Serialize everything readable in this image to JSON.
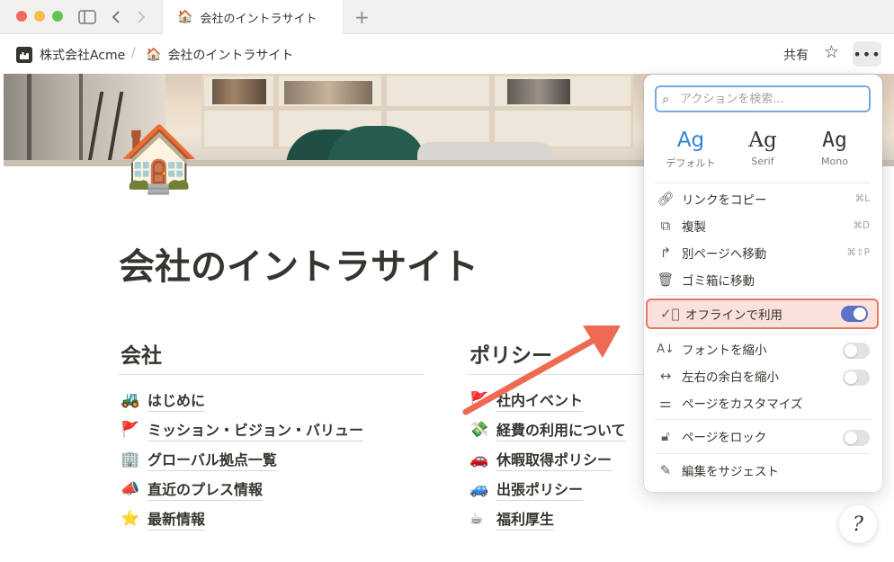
{
  "tab": {
    "emoji": "🏠",
    "title": "会社のイントラサイト"
  },
  "breadcrumb": {
    "workspace": "株式会社Acme",
    "separator": "/",
    "page_emoji": "🏠",
    "page": "会社のイントラサイト"
  },
  "topbar": {
    "share": "共有",
    "star_icon": "☆",
    "more_icon": "•••"
  },
  "page": {
    "icon": "🏠",
    "title": "会社のイントラサイト",
    "columns": [
      {
        "heading": "会社",
        "items": [
          {
            "emoji": "🚜",
            "label": "はじめに"
          },
          {
            "emoji": "🚩",
            "label": "ミッション・ビジョン・バリュー"
          },
          {
            "emoji": "🏢",
            "label": "グローバル拠点一覧"
          },
          {
            "emoji": "📣",
            "label": "直近のプレス情報"
          },
          {
            "emoji": "⭐",
            "label": "最新情報"
          }
        ]
      },
      {
        "heading": "ポリシー",
        "items": [
          {
            "emoji": "🚩",
            "label": "社内イベント"
          },
          {
            "emoji": "💸",
            "label": "経費の利用について"
          },
          {
            "emoji": "🚗",
            "label": "休暇取得ポリシー"
          },
          {
            "emoji": "🚙",
            "label": "出張ポリシー"
          },
          {
            "emoji": "☕",
            "label": "福利厚生"
          }
        ]
      }
    ]
  },
  "menu": {
    "search_placeholder": "アクションを検索...",
    "fonts": [
      {
        "sample": "Ag",
        "name": "デフォルト",
        "selected": true
      },
      {
        "sample": "Ag",
        "name": "Serif",
        "selected": false
      },
      {
        "sample": "Ag",
        "name": "Mono",
        "selected": false
      }
    ],
    "actions": [
      {
        "icon": "link-icon",
        "label": "リンクをコピー",
        "shortcut": "⌘L"
      },
      {
        "icon": "duplicate-icon",
        "label": "複製",
        "shortcut": "⌘D"
      },
      {
        "icon": "move-icon",
        "label": "別ページへ移動",
        "shortcut": "⌘⇧P"
      },
      {
        "icon": "trash-icon",
        "label": "ゴミ箱に移動",
        "shortcut": ""
      }
    ],
    "offline": {
      "label": "オフラインで利用",
      "enabled": true
    },
    "settings": [
      {
        "label": "フォントを縮小",
        "enabled": false
      },
      {
        "label": "左右の余白を縮小",
        "enabled": false
      },
      {
        "label": "ページをカスタマイズ"
      }
    ],
    "lock": {
      "label": "ページをロック",
      "enabled": false
    },
    "suggest": {
      "label": "編集をサジェスト"
    }
  },
  "colors": {
    "accent": "#2f84d8",
    "toggle_on": "#5d73c9",
    "highlight_bg": "#fae1dc",
    "highlight_border": "#e37a62",
    "arrow": "#ef6a52"
  },
  "help": {
    "icon": "?"
  }
}
